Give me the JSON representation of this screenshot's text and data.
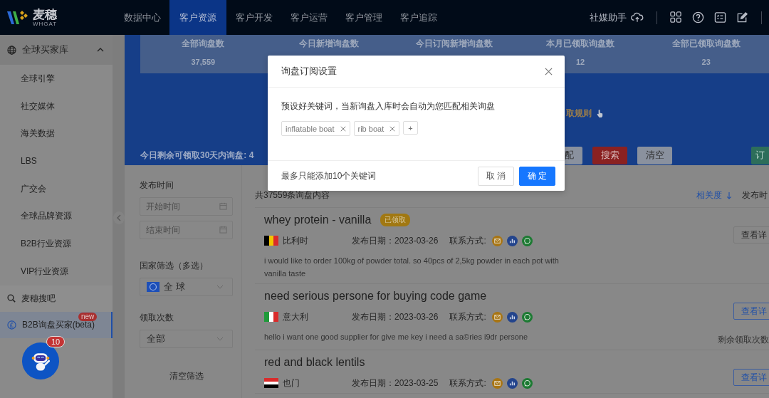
{
  "top_nav": {
    "logo": {
      "name": "麦穗",
      "subtitle": "WHGAT"
    },
    "items": [
      {
        "label": "数据中心",
        "selected": false
      },
      {
        "label": "客户资源",
        "selected": true
      },
      {
        "label": "客户开发",
        "selected": false
      },
      {
        "label": "客户运营",
        "selected": false
      },
      {
        "label": "客户管理",
        "selected": false
      },
      {
        "label": "客户追踪",
        "selected": false
      }
    ],
    "assistant": "社媒助手"
  },
  "sidebar": {
    "items": [
      {
        "kind": "group",
        "label": "全球买家库",
        "expanded": true,
        "selected": false
      },
      {
        "kind": "sub",
        "label": "全球引擎",
        "selected": false
      },
      {
        "kind": "sub",
        "label": "社交媒体",
        "selected": false
      },
      {
        "kind": "sub",
        "label": "海关数据",
        "selected": false
      },
      {
        "kind": "sub",
        "label": "LBS",
        "selected": false
      },
      {
        "kind": "sub",
        "label": "广交会",
        "selected": false
      },
      {
        "kind": "sub",
        "label": "全球品牌资源",
        "selected": false
      },
      {
        "kind": "sub",
        "label": "B2B行业资源",
        "selected": false
      },
      {
        "kind": "sub",
        "label": "VIP行业资源",
        "selected": false
      },
      {
        "kind": "search",
        "label": "麦穗搜吧",
        "selected": false
      },
      {
        "kind": "coin",
        "label": "B2B询盘买家(beta)",
        "badge": "new",
        "selected": true
      }
    ],
    "assistant_badge": "10"
  },
  "banner": {
    "stats": [
      {
        "label": "全部询盘数",
        "value": "37,559"
      },
      {
        "label": "今日新增询盘数"
      },
      {
        "label": "今日订阅新增询盘数"
      },
      {
        "label": "本月已领取询盘数",
        "value": "12"
      },
      {
        "label": "全部已领取询盘数",
        "value": "23"
      }
    ],
    "rules_link": "取规则",
    "quota": "今日剩余可领取30天内询盘: 4",
    "buttons": [
      {
        "label": "配",
        "kind": "default"
      },
      {
        "label": "搜索",
        "kind": "danger"
      },
      {
        "label": "清空",
        "kind": "default"
      },
      {
        "label": "订",
        "kind": "success"
      }
    ]
  },
  "filters": {
    "date_label": "发布时间",
    "start_placeholder": "开始时间",
    "end_placeholder": "结束时间",
    "country_label": "国家筛选（多选）",
    "country_value": "全 球",
    "count_label": "领取次数",
    "count_value": "全部",
    "clear": "清空筛选"
  },
  "list": {
    "total": "共37559条询盘内容",
    "sort": [
      {
        "label": "相关度",
        "selected": true
      },
      {
        "label": "发布时",
        "selected": false
      }
    ],
    "items": [
      {
        "title": "whey protein - vanilla",
        "badge": "已领取",
        "claimed": true,
        "flag": {
          "kind": "vertical",
          "stripes": [
            {
              "color": "#000000"
            },
            {
              "color": "#f2c500"
            },
            {
              "color": "#d92b2b"
            }
          ]
        },
        "country": "比利时",
        "date_label": "发布日期：",
        "date": "2023-03-26",
        "contact_label": "联系方式:",
        "detail": "查看详",
        "description": "i would like to order 100kg of powder total. so 40pcs of 2,5kg powder in each pot with vanilla taste"
      },
      {
        "title": "need serious persone for buying code game",
        "claimed": false,
        "flag": {
          "kind": "vertical",
          "stripes": [
            {
              "color": "#1f9a3a"
            },
            {
              "color": "#ffffff"
            },
            {
              "color": "#d92b2b"
            }
          ]
        },
        "country": "意大利",
        "date_label": "发布日期：",
        "date": "2023-03-26",
        "contact_label": "联系方式:",
        "detail": "查看详",
        "description": "hello i want one good supplier for give me key i need a sa©ries i9dr persone",
        "remaining": "剩余领取次数"
      },
      {
        "title": "red and black lentils",
        "claimed": false,
        "flag": {
          "kind": "horizontal",
          "stripes": [
            {
              "color": "#d92b2b"
            },
            {
              "color": "#ffffff"
            },
            {
              "color": "#000000"
            }
          ]
        },
        "country": "也门",
        "date_label": "发布日期：",
        "date": "2023-03-25",
        "contact_label": "联系方式:",
        "detail": "查看详"
      }
    ]
  },
  "dialog": {
    "title": "询盘订阅设置",
    "description": "预设好关键词，当新询盘入库时会自动为您匹配相关询盘",
    "tags": [
      {
        "label": "inflatable boat"
      },
      {
        "label": "rib boat"
      }
    ],
    "add": "+",
    "note": "最多只能添加10个关键词",
    "cancel": "取 消",
    "confirm": "确 定"
  }
}
